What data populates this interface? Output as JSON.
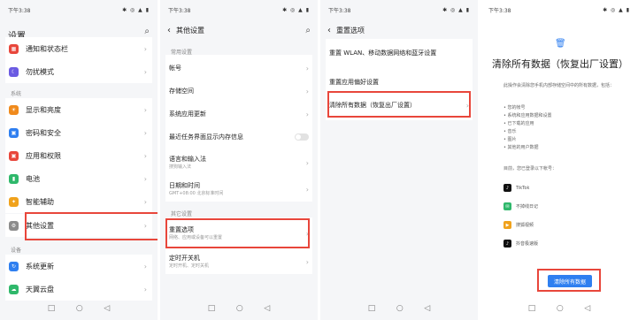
{
  "status_time": "下午3:38",
  "status_icons": "✱ ◎ ▲ ▮",
  "nav_keys": {
    "recents": "□",
    "home": "○",
    "back": "◁"
  },
  "panel1": {
    "title": "设置",
    "section_system": "系统",
    "section_device": "设备",
    "items": [
      {
        "label": "通知和状态栏",
        "color": "#e8463b",
        "icon": "▦"
      },
      {
        "label": "勿扰模式",
        "color": "#6b5be2",
        "icon": "☾"
      },
      {
        "label": "显示和亮度",
        "color": "#f08a1c",
        "icon": "☀"
      },
      {
        "label": "密码和安全",
        "color": "#2f7ff0",
        "icon": "🔒"
      },
      {
        "label": "应用和权限",
        "color": "#e8463b",
        "icon": "▣"
      },
      {
        "label": "电池",
        "color": "#2fb86b",
        "icon": "▮"
      },
      {
        "label": "智能辅助",
        "color": "#f0a21c",
        "icon": "✦"
      },
      {
        "label": "其他设置",
        "color": "#8c8c8c",
        "icon": "⚙"
      },
      {
        "label": "系统更新",
        "color": "#2f7ff0",
        "icon": "↻"
      },
      {
        "label": "天翼云盘",
        "color": "#2fb86b",
        "icon": "☁"
      }
    ]
  },
  "panel2": {
    "title": "其他设置",
    "section_common": "常用设置",
    "section_other": "其它设置",
    "items": [
      {
        "label": "帐号",
        "sub": ""
      },
      {
        "label": "存储空间",
        "sub": ""
      },
      {
        "label": "系统应用更新",
        "sub": ""
      },
      {
        "label": "最近任务界面显示内存信息",
        "sub": ""
      },
      {
        "label": "语言和输入法",
        "sub": "搜狗输入法"
      },
      {
        "label": "日期和时间",
        "sub": "GMT+08:00 北京标准时间"
      },
      {
        "label": "重置选项",
        "sub": "网络、应用或设备可以重置"
      },
      {
        "label": "定时开关机",
        "sub": "定时开机、定时关机"
      }
    ]
  },
  "panel3": {
    "title": "重置选项",
    "items": [
      {
        "label": "重置 WLAN、移动数据网络和蓝牙设置"
      },
      {
        "label": "重置应用偏好设置"
      },
      {
        "label": "清除所有数据（恢复出厂设置）"
      }
    ]
  },
  "panel4": {
    "title": "清除所有数据（恢复出厂设置）",
    "intro": "此操作会清除您手机内部存储空间中的所有数据，包括：",
    "bullets": [
      "您的帐号",
      "系统和应用数据和设置",
      "已下载的应用",
      "音乐",
      "图片",
      "其他的用户数据"
    ],
    "accounts_label": "目前，您已登录以下帐号：",
    "accounts": [
      {
        "name": "TikTok",
        "color": "#111111",
        "icon": "♪"
      },
      {
        "name": "不掉线日记",
        "color": "#2fb86b",
        "icon": "✉"
      },
      {
        "name": "搜狐视频",
        "color": "#f0a21c",
        "icon": "▶"
      },
      {
        "name": "抖音极速版",
        "color": "#111111",
        "icon": "♪"
      }
    ],
    "clear_button": "清除所有数据"
  },
  "highlight_color": "#e8463b"
}
